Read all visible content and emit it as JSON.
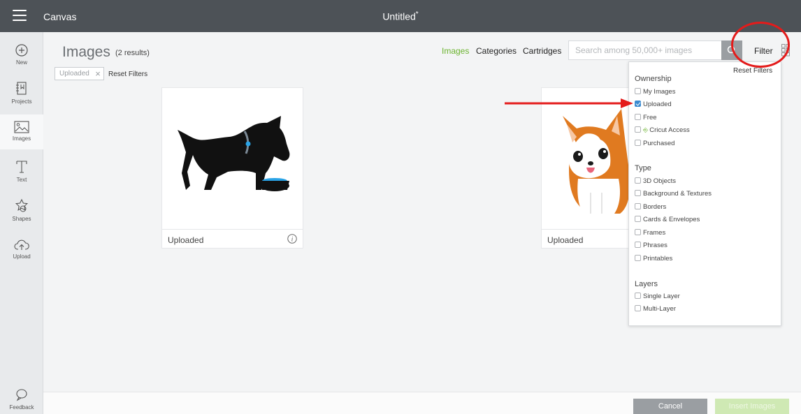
{
  "topbar": {
    "app_title": "Canvas",
    "doc_title": "Untitled",
    "unsaved_mark": "*"
  },
  "sidebar": {
    "items": [
      {
        "label": "New",
        "icon": "plus-circle-icon"
      },
      {
        "label": "Projects",
        "icon": "projects-icon"
      },
      {
        "label": "Images",
        "icon": "image-icon"
      },
      {
        "label": "Text",
        "icon": "text-icon"
      },
      {
        "label": "Shapes",
        "icon": "shapes-icon"
      },
      {
        "label": "Upload",
        "icon": "upload-cloud-icon"
      }
    ],
    "feedback_label": "Feedback"
  },
  "header": {
    "title": "Images",
    "results": "(2 results)",
    "active_filter_chip": "Uploaded",
    "reset_filters": "Reset Filters"
  },
  "nav": {
    "images": "Images",
    "categories": "Categories",
    "cartridges": "Cartridges",
    "search_placeholder": "Search among 50,000+ images",
    "filter": "Filter"
  },
  "cards": [
    {
      "label": "Uploaded",
      "image": "black-dog-with-bowl"
    },
    {
      "label": "Uploaded",
      "image": "corgi-puppy"
    }
  ],
  "filter_panel": {
    "reset_filters": "Reset Filters",
    "ownership": {
      "title": "Ownership",
      "options": [
        {
          "label": "My Images",
          "checked": false
        },
        {
          "label": "Uploaded",
          "checked": true
        },
        {
          "label": "Free",
          "checked": false
        },
        {
          "label": "Cricut Access",
          "checked": false
        },
        {
          "label": "Purchased",
          "checked": false
        }
      ]
    },
    "type": {
      "title": "Type",
      "options": [
        {
          "label": "3D Objects",
          "checked": false
        },
        {
          "label": "Background & Textures",
          "checked": false
        },
        {
          "label": "Borders",
          "checked": false
        },
        {
          "label": "Cards & Envelopes",
          "checked": false
        },
        {
          "label": "Frames",
          "checked": false
        },
        {
          "label": "Phrases",
          "checked": false
        },
        {
          "label": "Printables",
          "checked": false
        }
      ]
    },
    "layers": {
      "title": "Layers",
      "options": [
        {
          "label": "Single Layer",
          "checked": false
        },
        {
          "label": "Multi-Layer",
          "checked": false
        }
      ]
    }
  },
  "footer": {
    "cancel": "Cancel",
    "insert": "Insert Images"
  },
  "colors": {
    "accent_green": "#6bb32e",
    "topbar": "#4d5257",
    "checkbox_blue": "#3b8bd0",
    "annotation_red": "#e41b1b"
  }
}
